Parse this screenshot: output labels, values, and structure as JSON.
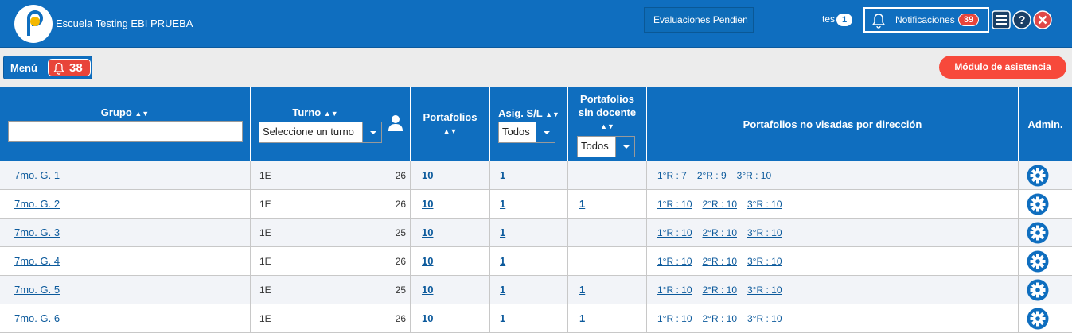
{
  "header": {
    "school_name": "Escuela Testing EBI PRUEBA",
    "eval_label": "Evaluaciones Pendien",
    "tes_label": "tes",
    "tes_count": "1",
    "notif_label": "Notificaciones",
    "notif_count": "39"
  },
  "toolbar": {
    "menu_label": "Menú",
    "menu_count": "38",
    "asistencia_label": "Módulo de asistencia"
  },
  "table": {
    "headers": {
      "grupo": "Grupo",
      "turno": "Turno",
      "portafolios": "Portafolios",
      "asig": "Asig. S/L",
      "sin_docente_1": "Portafolios",
      "sin_docente_2": "sin docente",
      "no_visadas": "Portafolios no visadas por dirección",
      "admin": "Admin."
    },
    "filters": {
      "grupo_value": "",
      "turno_placeholder": "Seleccione un turno",
      "asig_value": "Todos",
      "sin_docente_value": "Todos"
    },
    "rows": [
      {
        "grupo": "7mo. G. 1",
        "turno": "1E",
        "alumnos": "26",
        "portafolios": "10",
        "asig": "1",
        "sin_docente": "",
        "r1": "1°R : 7",
        "r2": "2°R : 9",
        "r3": "3°R : 10"
      },
      {
        "grupo": "7mo. G. 2",
        "turno": "1E",
        "alumnos": "26",
        "portafolios": "10",
        "asig": "1",
        "sin_docente": "1",
        "r1": "1°R : 10",
        "r2": "2°R : 10",
        "r3": "3°R : 10"
      },
      {
        "grupo": "7mo. G. 3",
        "turno": "1E",
        "alumnos": "25",
        "portafolios": "10",
        "asig": "1",
        "sin_docente": "",
        "r1": "1°R : 10",
        "r2": "2°R : 10",
        "r3": "3°R : 10"
      },
      {
        "grupo": "7mo. G. 4",
        "turno": "1E",
        "alumnos": "26",
        "portafolios": "10",
        "asig": "1",
        "sin_docente": "",
        "r1": "1°R : 10",
        "r2": "2°R : 10",
        "r3": "3°R : 10"
      },
      {
        "grupo": "7mo. G. 5",
        "turno": "1E",
        "alumnos": "25",
        "portafolios": "10",
        "asig": "1",
        "sin_docente": "1",
        "r1": "1°R : 10",
        "r2": "2°R : 10",
        "r3": "3°R : 10"
      },
      {
        "grupo": "7mo. G. 6",
        "turno": "1E",
        "alumnos": "26",
        "portafolios": "10",
        "asig": "1",
        "sin_docente": "1",
        "r1": "1°R : 10",
        "r2": "2°R : 10",
        "r3": "3°R : 10"
      }
    ]
  },
  "colors": {
    "primary": "#0f6ebf",
    "alert": "#e8443a",
    "asistencia": "#f7493b"
  }
}
